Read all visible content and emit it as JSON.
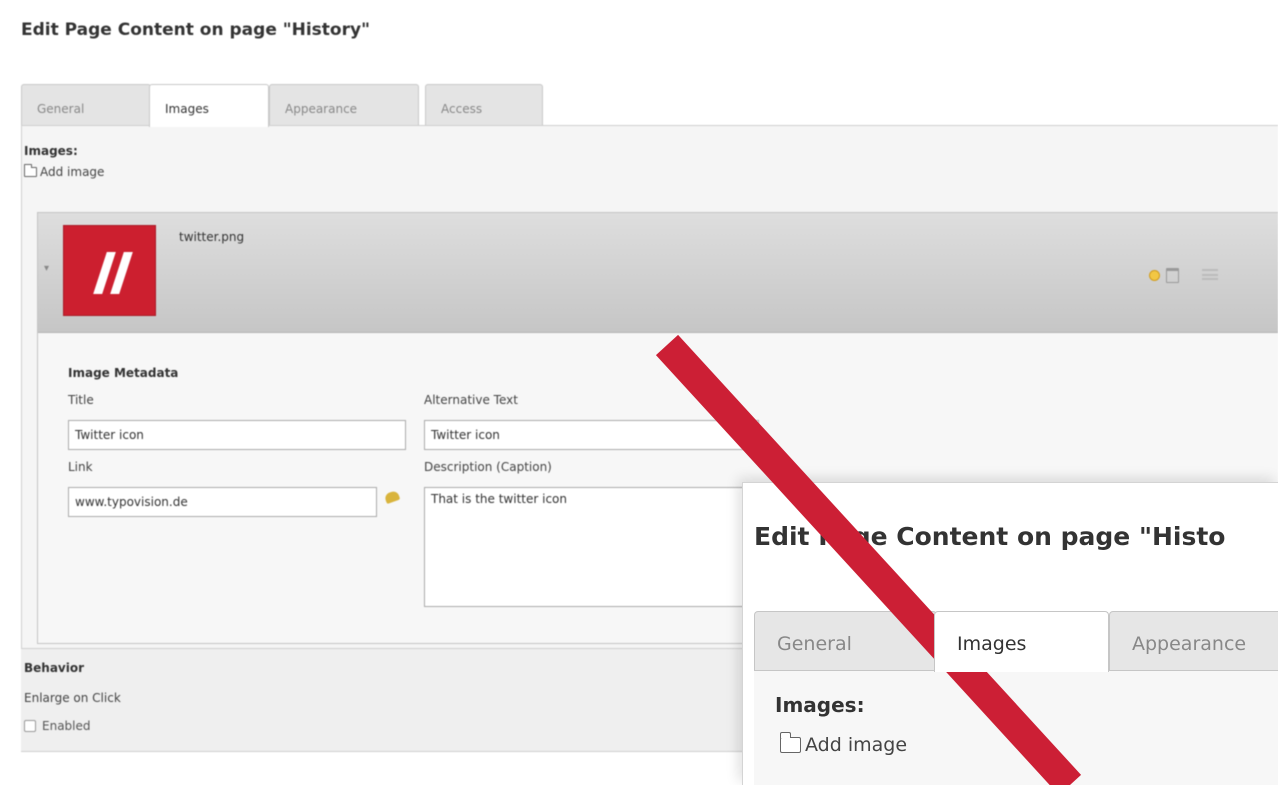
{
  "page": {
    "title": "Edit Page Content on page \"History\""
  },
  "tabs": [
    {
      "label": "General"
    },
    {
      "label": "Images"
    },
    {
      "label": "Appearance"
    },
    {
      "label": "Access"
    }
  ],
  "images": {
    "section_label": "Images:",
    "add_image_label": "Add image",
    "file": {
      "name": "twitter.png",
      "thumbnail_color": "#cc1f2f"
    }
  },
  "metadata": {
    "heading": "Image Metadata",
    "title_label": "Title",
    "title_value": "Twitter icon",
    "alt_label": "Alternative Text",
    "alt_value": "Twitter icon",
    "link_label": "Link",
    "link_value": "www.typovision.de",
    "caption_label": "Description (Caption)",
    "caption_value": "That is the twitter icon"
  },
  "behavior": {
    "title": "Behavior",
    "enlarge_label": "Enlarge on Click",
    "enabled_label": "Enabled",
    "enabled": false
  },
  "inset": {
    "title": "Edit Page Content on page \"Histo",
    "tabs": [
      "General",
      "Images",
      "Appearance"
    ],
    "images_label": "Images:",
    "add_image_label": "Add image"
  },
  "icons": [
    "folder-icon",
    "collapse-icon",
    "hint-icon",
    "delete-icon",
    "drag-icon",
    "link-wizard-icon"
  ],
  "colors": {
    "strike": "#cc1f35",
    "thumbnail": "#cc1f2f",
    "header_gradient_top": "#dedede",
    "header_gradient_bottom": "#c6c6c6"
  }
}
